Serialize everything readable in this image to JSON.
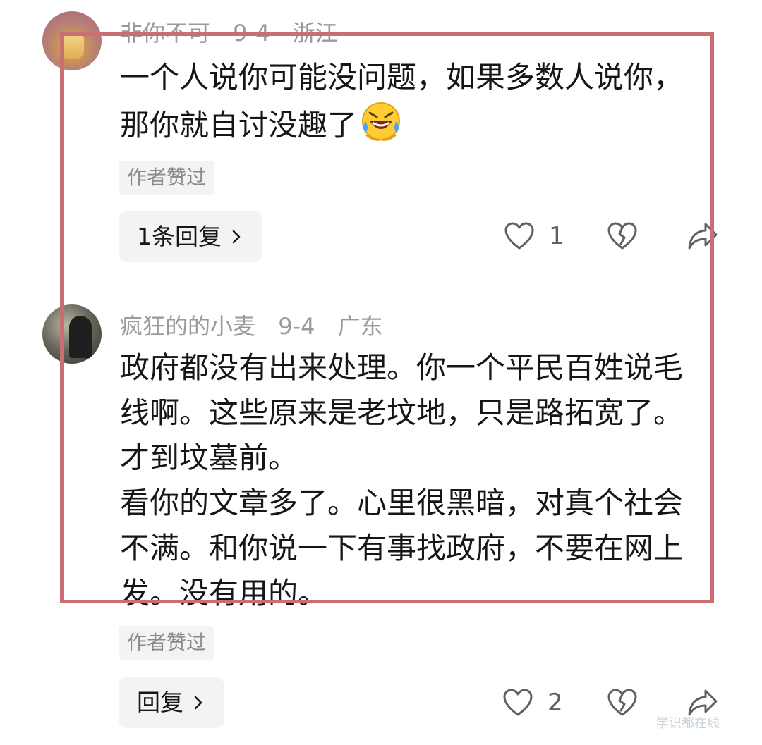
{
  "comments": [
    {
      "username": "非你不可",
      "date": "9-4",
      "location": "浙江",
      "text": "一个人说你可能没问题，如果多数人说你，那你就自讨没趣了",
      "emoji": "laughing-tears-emoji",
      "badge": "作者赞过",
      "reply_label": "1条回复",
      "like_count": "1"
    },
    {
      "username": "疯狂的的小麦",
      "date": "9-4",
      "location": "广东",
      "text": "政府都没有出来处理。你一个平民百姓说毛线啊。这些原来是老坟地，只是路拓宽了。才到坟墓前。\n看你的文章多了。心里很黑暗，对真个社会不满。和你说一下有事找政府，不要在网上发。没有用的。",
      "badge": "作者赞过",
      "reply_label": "回复",
      "like_count": "2"
    }
  ],
  "annotation": {
    "highlight_color": "#c96f73"
  },
  "colors": {
    "text": "#161616",
    "meta": "#9a9a9a",
    "pill_bg": "#f3f3f3"
  },
  "watermark": "学识都在线"
}
